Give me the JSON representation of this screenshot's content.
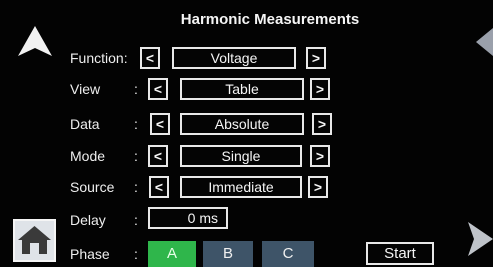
{
  "title": "Harmonic Measurements",
  "rows": {
    "function": {
      "label": "Function:",
      "value": "Voltage"
    },
    "view": {
      "label": "View",
      "value": "Table"
    },
    "data": {
      "label": "Data",
      "value": "Absolute"
    },
    "mode": {
      "label": "Mode",
      "value": "Single"
    },
    "source": {
      "label": "Source",
      "value": "Immediate"
    },
    "delay": {
      "label": "Delay",
      "value": "0 ms"
    },
    "phase": {
      "label": "Phase"
    }
  },
  "colon": ":",
  "prev_label": "<",
  "next_label": ">",
  "phase_buttons": [
    "A",
    "B",
    "C"
  ],
  "phase_selected": "A",
  "start_label": "Start",
  "icons": {
    "up": "up-arrow-icon",
    "home": "home-icon",
    "left": "left-chevron-icon",
    "right": "right-chevron-icon"
  },
  "colors": {
    "active_phase": "#2fb64b",
    "inactive_phase": "#3e5468",
    "border": "#e8e8e8"
  }
}
